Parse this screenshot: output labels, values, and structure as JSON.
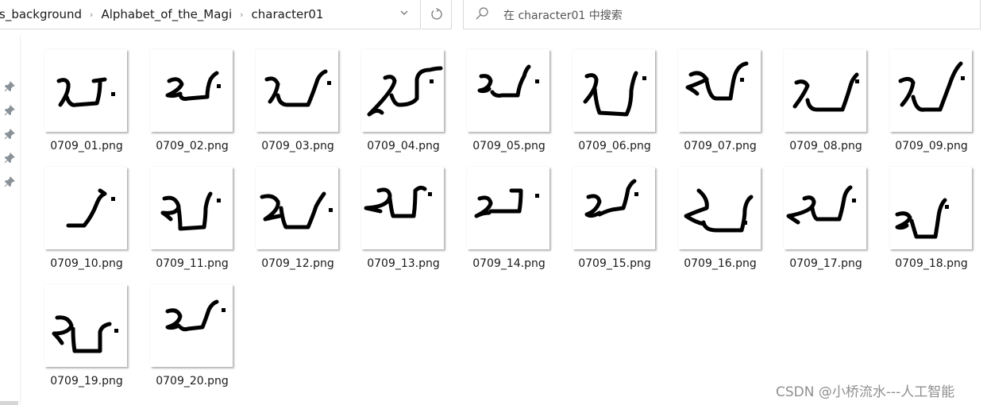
{
  "breadcrumb": {
    "items": [
      "s_background",
      "Alphabet_of_the_Magi",
      "character01"
    ],
    "separator": "›",
    "dropdown_icon": "chevron-down-icon",
    "refresh_icon": "refresh-icon"
  },
  "search": {
    "placeholder": "在 character01 中搜索",
    "icon": "search-icon"
  },
  "quick_access": {
    "pins": [
      "pin-icon",
      "pin-icon",
      "pin-icon",
      "pin-icon",
      "pin-icon"
    ]
  },
  "files": [
    {
      "name": "0709_01.png"
    },
    {
      "name": "0709_02.png"
    },
    {
      "name": "0709_03.png"
    },
    {
      "name": "0709_04.png"
    },
    {
      "name": "0709_05.png"
    },
    {
      "name": "0709_06.png"
    },
    {
      "name": "0709_07.png"
    },
    {
      "name": "0709_08.png"
    },
    {
      "name": "0709_09.png"
    },
    {
      "name": "0709_10.png"
    },
    {
      "name": "0709_11.png"
    },
    {
      "name": "0709_12.png"
    },
    {
      "name": "0709_13.png"
    },
    {
      "name": "0709_14.png"
    },
    {
      "name": "0709_15.png"
    },
    {
      "name": "0709_16.png"
    },
    {
      "name": "0709_17.png"
    },
    {
      "name": "0709_18.png"
    },
    {
      "name": "0709_19.png"
    },
    {
      "name": "0709_20.png"
    }
  ],
  "watermark": "CSDN @小桥流水---人工智能",
  "colors": {
    "border": "#d9d9d9",
    "stroke": "#000000",
    "watermark": "#8f8f8f"
  }
}
